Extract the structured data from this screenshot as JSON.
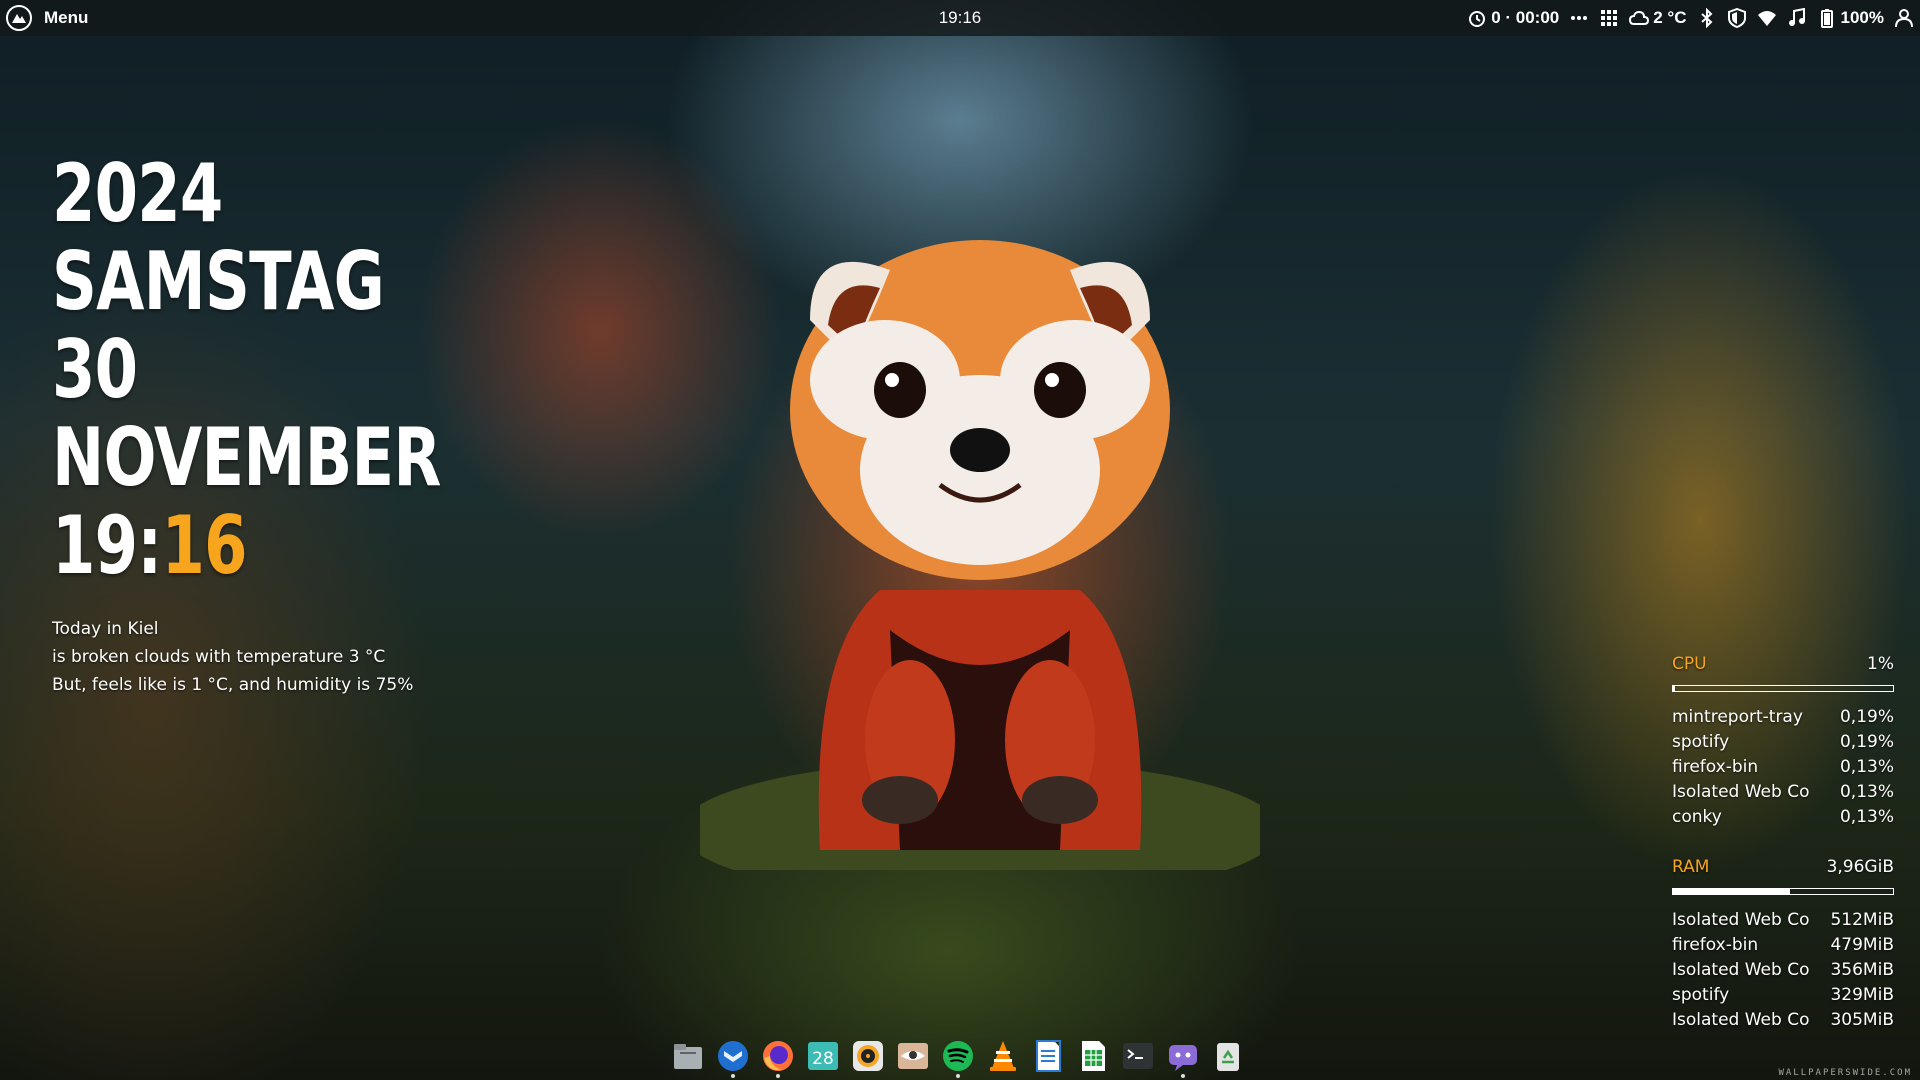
{
  "panel": {
    "menu_label": "Menu",
    "clock": "19:16",
    "timer": "0 · 00:00",
    "weather_temp": "2 °C",
    "battery": "100%"
  },
  "conky_left": {
    "year": "2024",
    "weekday": "SAMSTAG",
    "day": "30",
    "month": "NOVEMBER",
    "hour": "19:",
    "minute": "16",
    "weather_line1": "Today in Kiel",
    "weather_line2": "is broken clouds with temperature 3 °C",
    "weather_line3": "But, feels like is 1 °C, and humidity is 75%"
  },
  "conky_right": {
    "cpu_label": "CPU",
    "cpu_value": "1%",
    "cpu_fraction": 0.01,
    "cpu_procs": [
      {
        "name": "mintreport-tray",
        "value": "0,19%"
      },
      {
        "name": "spotify",
        "value": "0,19%"
      },
      {
        "name": "firefox-bin",
        "value": "0,13%"
      },
      {
        "name": "Isolated Web Co",
        "value": "0,13%"
      },
      {
        "name": "conky",
        "value": "0,13%"
      }
    ],
    "ram_label": "RAM",
    "ram_value": "3,96GiB",
    "ram_fraction": 0.53,
    "ram_procs": [
      {
        "name": "Isolated Web Co",
        "value": "512MiB"
      },
      {
        "name": "firefox-bin",
        "value": "479MiB"
      },
      {
        "name": "Isolated Web Co",
        "value": "356MiB"
      },
      {
        "name": "spotify",
        "value": "329MiB"
      },
      {
        "name": "Isolated Web Co",
        "value": "305MiB"
      }
    ]
  },
  "dock": {
    "calendar_day": "28"
  },
  "watermark": "WALLPAPERSWIDE.COM",
  "colors": {
    "accent": "#f7a51c",
    "panel_bg": "#14181a"
  }
}
